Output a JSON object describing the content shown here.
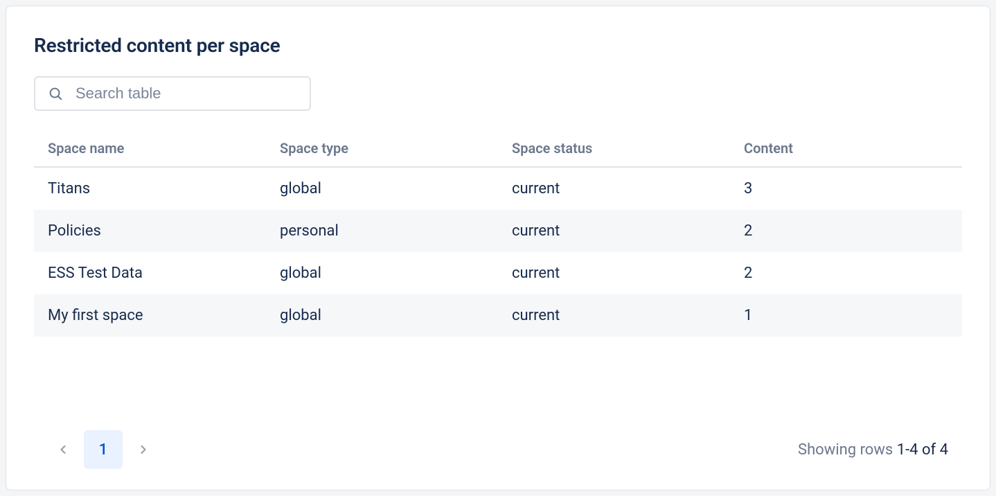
{
  "title": "Restricted content per space",
  "search": {
    "placeholder": "Search table",
    "value": ""
  },
  "table": {
    "columns": [
      "Space name",
      "Space type",
      "Space status",
      "Content"
    ],
    "rows": [
      {
        "name": "Titans",
        "type": "global",
        "status": "current",
        "content": "3"
      },
      {
        "name": "Policies",
        "type": "personal",
        "status": "current",
        "content": "2"
      },
      {
        "name": "ESS Test Data",
        "type": "global",
        "status": "current",
        "content": "2"
      },
      {
        "name": "My first space",
        "type": "global",
        "status": "current",
        "content": "1"
      }
    ]
  },
  "pagination": {
    "current_page": "1",
    "showing_label": "Showing rows ",
    "range": "1-4",
    "of_label": " of ",
    "total": "4"
  }
}
